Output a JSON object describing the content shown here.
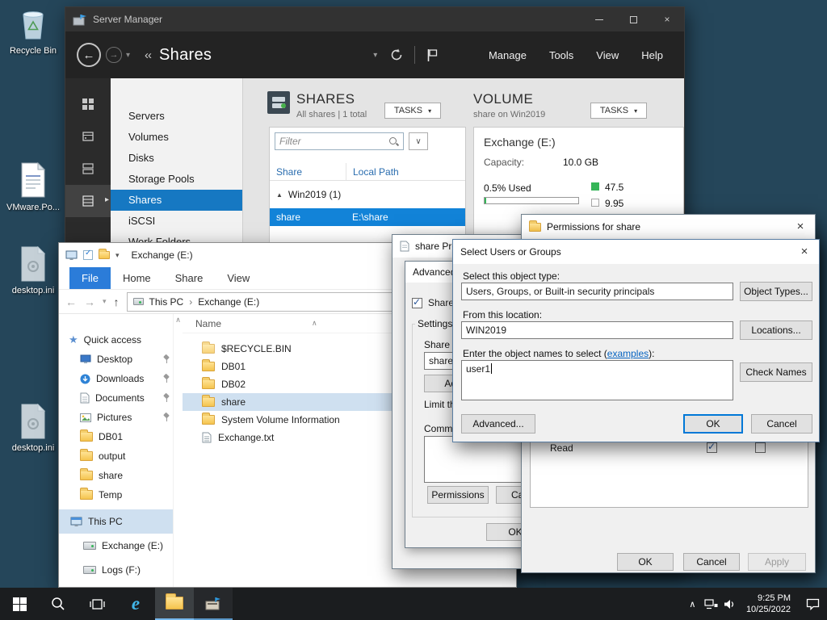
{
  "icons": {
    "back_arrow": "←",
    "forward_arrow": "→",
    "up_arrow": "↑",
    "down_arrow": "↓",
    "dropdown": "▾",
    "expand_more": "∨",
    "collapse_chevron": "∧",
    "breadcrumb_sep": "›",
    "close": "×",
    "star": "★",
    "sort_asc": "∧",
    "group_collapse": "▲",
    "flyout": "▸"
  },
  "desktop": {
    "icons": [
      {
        "label": "Recycle Bin"
      },
      {
        "label": "VMware.Po..."
      },
      {
        "label": "desktop.ini"
      },
      {
        "label": "desktop.ini"
      }
    ]
  },
  "server_manager": {
    "window_title": "Server Manager",
    "breadcrumb_collapse": "‹‹",
    "breadcrumb": "Shares",
    "menus": [
      {
        "label": "Manage"
      },
      {
        "label": "Tools"
      },
      {
        "label": "View"
      },
      {
        "label": "Help"
      }
    ],
    "subnav": [
      {
        "label": "Servers"
      },
      {
        "label": "Volumes"
      },
      {
        "label": "Disks"
      },
      {
        "label": "Storage Pools"
      },
      {
        "label": "Shares"
      },
      {
        "label": "iSCSI"
      },
      {
        "label": "Work Folders"
      }
    ],
    "shares": {
      "title": "SHARES",
      "subtitle": "All shares | 1 total",
      "tasks": "TASKS",
      "filter_placeholder": "Filter",
      "col_share": "Share",
      "col_path": "Local Path",
      "group": "Win2019 (1)",
      "row": {
        "share": "share",
        "path": "E:\\share"
      }
    },
    "volume": {
      "title": "VOLUME",
      "subtitle": "share on Win2019",
      "tasks": "TASKS",
      "name": "Exchange (E:)",
      "capacity_label": "Capacity:",
      "capacity": "10.0 GB",
      "used": "0.5% Used",
      "used_value": "47.5",
      "free_value": "9.95"
    }
  },
  "explorer": {
    "title": "Exchange (E:)",
    "tabs": [
      {
        "label": "File"
      },
      {
        "label": "Home"
      },
      {
        "label": "Share"
      },
      {
        "label": "View"
      }
    ],
    "address": [
      {
        "label": "This PC"
      },
      {
        "label": "Exchange (E:)"
      }
    ],
    "nav": [
      {
        "label": "Quick access"
      },
      {
        "label": "Desktop"
      },
      {
        "label": "Downloads"
      },
      {
        "label": "Documents"
      },
      {
        "label": "Pictures"
      },
      {
        "label": "DB01"
      },
      {
        "label": "output"
      },
      {
        "label": "share"
      },
      {
        "label": "Temp"
      },
      {
        "label": "This PC"
      },
      {
        "label": "Exchange (E:)"
      },
      {
        "label": "Logs (F:)"
      }
    ],
    "name_column": "Name",
    "files": [
      {
        "name": "$RECYCLE.BIN"
      },
      {
        "name": "DB01"
      },
      {
        "name": "DB02"
      },
      {
        "name": "share"
      },
      {
        "name": "System Volume Information"
      },
      {
        "name": "Exchange.txt"
      }
    ]
  },
  "share_properties": {
    "title": "share Properties",
    "advanced_sharing": {
      "title": "Advanced Sharing",
      "share_checkbox": "Share this folder",
      "settings": "Settings",
      "share_name_label": "Share name:",
      "share_name": "share",
      "add": "Add",
      "limit_label": "Limit the number of simultaneous users to:",
      "comments_label": "Comments:",
      "permissions": "Permissions",
      "caching": "Caching",
      "ok": "OK"
    }
  },
  "permissions": {
    "title": "Permissions for share",
    "read": "Read",
    "ok": "OK",
    "cancel": "Cancel",
    "apply": "Apply"
  },
  "select_users": {
    "title": "Select Users or Groups",
    "object_type_label": "Select this object type:",
    "object_type": "Users, Groups, or Built-in security principals",
    "object_types_btn": "Object Types...",
    "location_label": "From this location:",
    "location": "WIN2019",
    "locations_btn": "Locations...",
    "names_label": "Enter the object names to select (",
    "examples_link": "examples",
    "names_label_end": "):",
    "names_value": "user1",
    "check_names_btn": "Check Names",
    "advanced_btn": "Advanced...",
    "ok": "OK",
    "cancel": "Cancel"
  },
  "taskbar": {
    "time": "9:25 PM",
    "date": "10/25/2022"
  }
}
